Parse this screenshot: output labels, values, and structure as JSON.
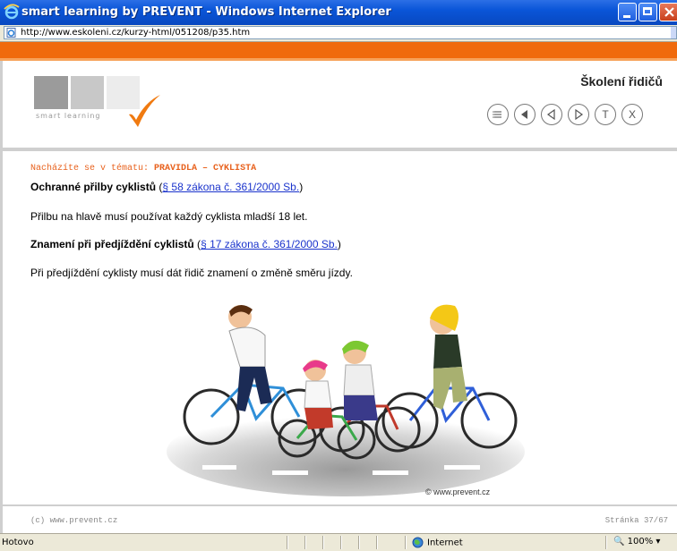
{
  "window": {
    "title": "smart learning by PREVENT - Windows Internet Explorer"
  },
  "address_bar": {
    "url": "http://www.eskoleni.cz/kurzy-html/051208/p35.htm"
  },
  "header": {
    "logo_text": "smart learning",
    "course_title": "Školení řidičů",
    "nav_buttons": {
      "menu": "menu-icon",
      "first": "first-icon",
      "prev": "prev-icon",
      "next": "next-icon",
      "test": "T",
      "exit": "X"
    }
  },
  "content": {
    "breadcrumb_prefix": "Nacházíte se v tématu:",
    "breadcrumb_topic": "PRAVIDLA – CYKLISTA",
    "heading1": "Ochranné přilby cyklistů",
    "heading1_open": " (",
    "link1": "§ 58 zákona č. 361/2000 Sb.",
    "heading1_close": ")",
    "para1": "Přilbu na hlavě musí používat každý cyklista mladší 18 let.",
    "heading2": "Znamení při předjíždění cyklistů",
    "heading2_open": " (",
    "link2": "§ 17 zákona č. 361/2000 Sb.",
    "heading2_close": ")",
    "para2": "Při předjíždění cyklisty musí dát řidič znamení o změně směru jízdy.",
    "image_credit": "© www.prevent.cz"
  },
  "footer": {
    "copyright": "(c) www.prevent.cz",
    "page_indicator": "Stránka 37/67"
  },
  "status_bar": {
    "status": "Hotovo",
    "zone": "Internet",
    "zoom": "100%"
  },
  "colors": {
    "orange": "#f06a0c",
    "link": "#1a33cc",
    "breadcrumb": "#e8621e"
  }
}
